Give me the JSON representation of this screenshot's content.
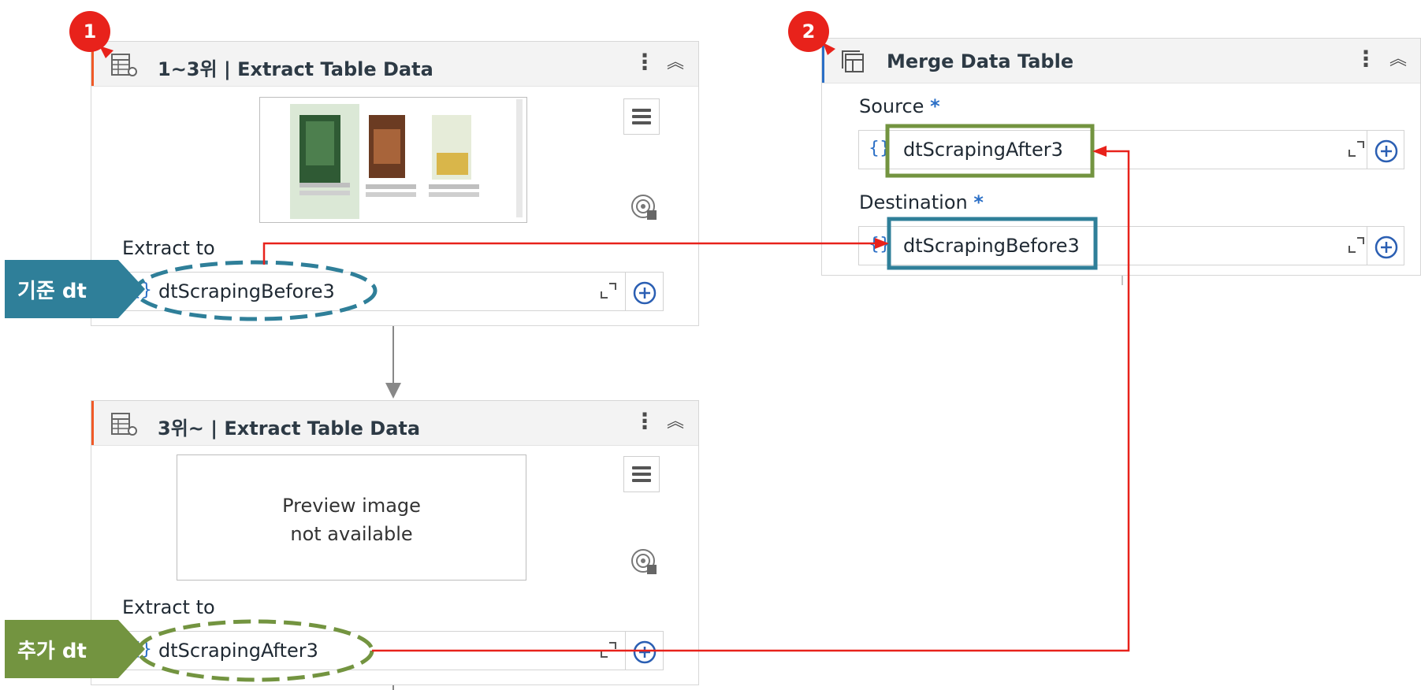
{
  "card1": {
    "title": "1~3위 | Extract Table Data",
    "extract_label": "Extract to",
    "variable": "dtScrapingBefore3",
    "brace": "{}"
  },
  "card2": {
    "title": "3위~ | Extract Table Data",
    "preview_line1": "Preview image",
    "preview_line2": "not available",
    "extract_label": "Extract to",
    "variable": "dtScrapingAfter3",
    "brace": "{}"
  },
  "merge": {
    "title": "Merge Data Table",
    "source_label": "Source",
    "destination_label": "Destination",
    "required_mark": "*",
    "source_value": "dtScrapingAfter3",
    "destination_value": "dtScrapingBefore3",
    "brace": "{}"
  },
  "annotations": {
    "badge1": "1",
    "badge2": "2",
    "base_label": "기준 dt",
    "add_label": "추가 dt"
  },
  "colors": {
    "teal": "#2f7f99",
    "green": "#739440",
    "red": "#e8221b",
    "accent_orange": "#f05a28",
    "accent_blue": "#2b6fc6"
  }
}
